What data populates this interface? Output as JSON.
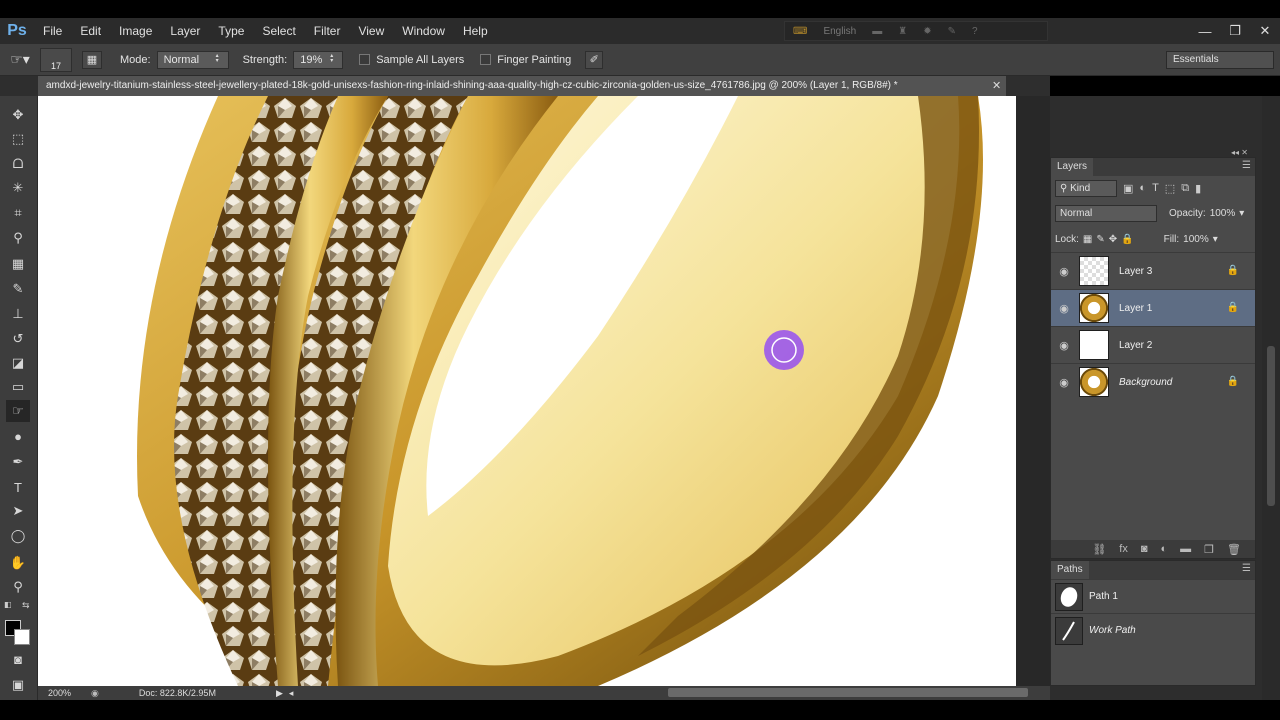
{
  "app": {
    "logo": "Ps"
  },
  "menu": {
    "items": [
      "File",
      "Edit",
      "Image",
      "Layer",
      "Type",
      "Select",
      "Filter",
      "View",
      "Window",
      "Help"
    ]
  },
  "menu_right": {
    "language": "English"
  },
  "window_controls": {
    "minimize": "—",
    "restore": "❐",
    "close": "✕"
  },
  "options": {
    "brush_size": "17",
    "mode_label": "Mode:",
    "mode_value": "Normal",
    "strength_label": "Strength:",
    "strength_value": "19%",
    "sample_all_layers": "Sample All Layers",
    "finger_painting": "Finger Painting",
    "workspace": "Essentials"
  },
  "document": {
    "tab_title": "amdxd-jewelry-titanium-stainless-steel-jewellery-plated-18k-gold-unisexs-fashion-ring-inlaid-shining-aaa-quality-high-cz-cubic-zirconia-golden-us-size_4761786.jpg @ 200% (Layer 1, RGB/8#) *",
    "tab_close": "✕"
  },
  "status": {
    "zoom": "200%",
    "doc_info": "Doc: 822.8K/2.95M"
  },
  "layers_panel": {
    "title": "Layers",
    "filter_kind": "Kind",
    "blend_mode": "Normal",
    "opacity_label": "Opacity:",
    "opacity_value": "100%",
    "lock_label": "Lock:",
    "fill_label": "Fill:",
    "fill_value": "100%",
    "layers": [
      {
        "name": "Layer 3",
        "thumb": "checker",
        "selected": false,
        "locked": true
      },
      {
        "name": "Layer 1",
        "thumb": "ring",
        "selected": true,
        "locked": true
      },
      {
        "name": "Layer 2",
        "thumb": "white",
        "selected": false,
        "locked": false
      },
      {
        "name": "Background",
        "thumb": "ring",
        "selected": false,
        "locked": true
      }
    ]
  },
  "paths_panel": {
    "title": "Paths",
    "paths": [
      {
        "name": "Path 1"
      },
      {
        "name": "Work Path"
      }
    ]
  },
  "colors": {
    "ring_gold": "#c9962a",
    "ring_light": "#f5e39a",
    "ring_dark": "#6b4a0a",
    "smudge_cursor": "#8a3cff",
    "selected_layer": "#5e6d84"
  }
}
